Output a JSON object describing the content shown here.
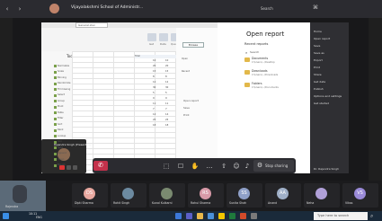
{
  "topbar": {
    "title": "Vijayalakshmi School of Administr...",
    "search_placeholder": "Search",
    "back_icon": "‹",
    "forward_icon": "›",
    "extra": "⌘"
  },
  "excel": {
    "name_box": "General.xlsx",
    "ribbon_labels": [
      "Get",
      "Data",
      "Query"
    ],
    "tools_title": "Tools",
    "tools_items": [
      "Normalize",
      "Scale",
      "Binning",
      "Randomize",
      "Fill missing",
      "Select",
      "Group",
      "Pivot",
      "Table",
      "Filter",
      "Sort",
      "Rank",
      "Lookup",
      "Join",
      "Split",
      "Append",
      "Clean",
      "Export"
    ],
    "middle_items": [
      "Open report",
      "Save",
      "Print"
    ],
    "column_header": "Total",
    "values": [
      "10",
      "20",
      "15",
      "8",
      "12",
      "30",
      "5",
      "9",
      "11",
      "7",
      "14",
      "25",
      "18"
    ]
  },
  "open_report": {
    "title": "Open report",
    "recent_label": "Recent reports",
    "search_label": "Search",
    "files": [
      {
        "name": "Documents",
        "path": "C:\\Users\\...\\Desktop"
      },
      {
        "name": "Downloads",
        "path": "C:\\Users\\...\\Downloads"
      },
      {
        "name": "Folders",
        "path": "C:\\Users\\...\\Documents"
      }
    ],
    "open_button": "Browse",
    "side_links": [
      "Open",
      "Recent"
    ]
  },
  "dark_nav": {
    "items": [
      "Home",
      "Open report",
      "Save",
      "Save as",
      "Export",
      "Print",
      "Share",
      "Get data",
      "Publish",
      "Options and settings",
      "Get started"
    ],
    "bottom": "Dr. Rajendra Singh"
  },
  "presenter": {
    "name": "Rajendra Singh (Presenting)"
  },
  "controls": {
    "stop_label": "Stop sharing",
    "hangup_icon": "✆",
    "icons": [
      "⬚",
      "☐",
      "✋",
      "…",
      "⇧",
      "☺",
      "♪",
      "⚙"
    ]
  },
  "participants": [
    {
      "initials": "DS",
      "name": "Dipti Sharma",
      "color": "#e8a8a0"
    },
    {
      "initials": "",
      "name": "Rohit Singh",
      "color": "#6c8aa0"
    },
    {
      "initials": "",
      "name": "Kunal Kulkarni",
      "color": "#7a8a70"
    },
    {
      "initials": "RS",
      "name": "Rahul Sharma",
      "color": "#d89aa8"
    },
    {
      "initials": "SS",
      "name": "Sunita Shah",
      "color": "#8fa0c8"
    },
    {
      "initials": "AA",
      "name": "Anand",
      "color": "#a0b0c8"
    },
    {
      "initials": "",
      "name": "Neha",
      "color": "#b0a0d8"
    },
    {
      "initials": "VS",
      "name": "Vikas",
      "color": "#9a8ad8"
    }
  ],
  "self": {
    "name": "Rajendra"
  },
  "taskbar": {
    "search_placeholder": "Type here to search",
    "time": "10:11",
    "date": "14-04-2021",
    "tray": "ENG"
  }
}
